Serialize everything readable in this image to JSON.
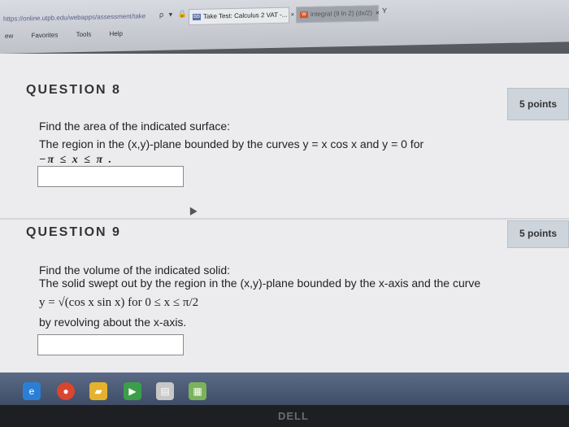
{
  "browser": {
    "url": "https://online.utpb.edu/webapps/assessment/take",
    "address_icons": "ρ ▾ 🔒 C",
    "tabs": [
      {
        "label": "Take Test: Calculus 2 VAT -...",
        "badge": "BB",
        "close": "×",
        "active": true
      },
      {
        "label": "integral (9 ln 2) (dx/2)",
        "badge": "W",
        "close": "×",
        "active": false
      }
    ],
    "new_tab_label": "Y",
    "menu": [
      "ew",
      "Favorites",
      "Tools",
      "Help"
    ]
  },
  "questions": [
    {
      "header": "QUESTION 8",
      "points": "5 points",
      "lines": [
        "Find the area of the indicated surface:",
        "The region in the (x,y)-plane bounded by the curves y = x cos x and y = 0 for",
        "−π ≤ x ≤ π ."
      ],
      "answer_value": ""
    },
    {
      "header": "QUESTION 9",
      "points": "5 points",
      "lines": [
        "Find the volume of the indicated solid:",
        "The solid swept out by the region in the (x,y)-plane bounded by the x-axis and the curve",
        "y = √(cos x sin x)  for  0 ≤ x ≤ π/2",
        "by revolving about the x-axis."
      ],
      "answer_value": ""
    }
  ],
  "taskbar": {
    "icons": [
      "ie-icon",
      "chrome-icon",
      "folder-icon",
      "media-icon",
      "document-icon",
      "calculator-icon"
    ],
    "colors": [
      "#2a7fd4",
      "#d9452f",
      "#e6b12d",
      "#3d9e4a",
      "#c7c7c7",
      "#7bb35c"
    ]
  },
  "bezel": {
    "logo": "DELL"
  }
}
